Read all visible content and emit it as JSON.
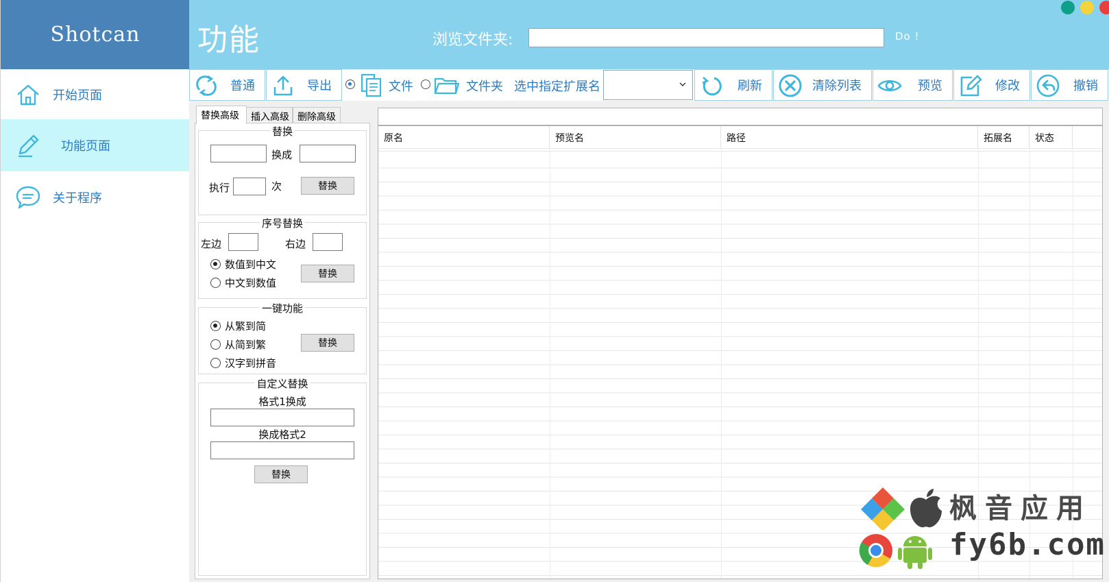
{
  "app": {
    "brand": "Shotcan",
    "window_controls": {
      "colors": [
        "#0fa08a",
        "#f4d33c",
        "#e8403c"
      ]
    }
  },
  "sidebar": {
    "items": [
      {
        "label": "开始页面",
        "icon": "home-icon",
        "active": false
      },
      {
        "label": "功能页面",
        "icon": "pencil-icon",
        "active": true
      },
      {
        "label": "关于程序",
        "icon": "chat-bubble-icon",
        "active": false
      }
    ]
  },
  "header": {
    "title": "功能",
    "browse_label": "浏览文件夹:",
    "browse_value": "",
    "do_label": "Do !"
  },
  "toolbar": {
    "normal_label": "普通",
    "export_label": "导出",
    "file_option": "文件",
    "folder_option": "文件夹",
    "ext_label": "选中指定扩展名",
    "ext_value": "",
    "refresh_label": "刷新",
    "clear_label": "清除列表",
    "preview_label": "预览",
    "modify_label": "修改",
    "undo_label": "撤销"
  },
  "tabs": [
    {
      "label": "替换高级",
      "active": true
    },
    {
      "label": "插入高级",
      "active": false
    },
    {
      "label": "删除高级",
      "active": false
    }
  ],
  "replace": {
    "title": "替换",
    "to_label": "换成",
    "exec_label": "执行",
    "times_label": "次",
    "button": "替换"
  },
  "seq_replace": {
    "title": "序号替换",
    "left_label": "左边",
    "right_label": "右边",
    "opt1": "数值到中文",
    "opt2": "中文到数值",
    "button": "替换"
  },
  "one_key": {
    "title": "一键功能",
    "opt1": "从繁到简",
    "opt2": "从简到繁",
    "opt3": "汉字到拼音",
    "button": "替换"
  },
  "custom_replace": {
    "title": "自定义替换",
    "fmt1_label": "格式1换成",
    "fmt2_label": "换成格式2",
    "button": "替换"
  },
  "grid": {
    "columns": [
      "原名",
      "预览名",
      "路径",
      "拓展名",
      "状态"
    ]
  },
  "watermark": {
    "line1": "枫音应用",
    "line2": "fy6b.com"
  },
  "colors": {
    "brand_bg": "#4a83b8",
    "header_bg": "#88d2ed",
    "accent": "#2a7cc4",
    "icon": "#3fb6dc",
    "active_nav": "#c8f7fb"
  }
}
